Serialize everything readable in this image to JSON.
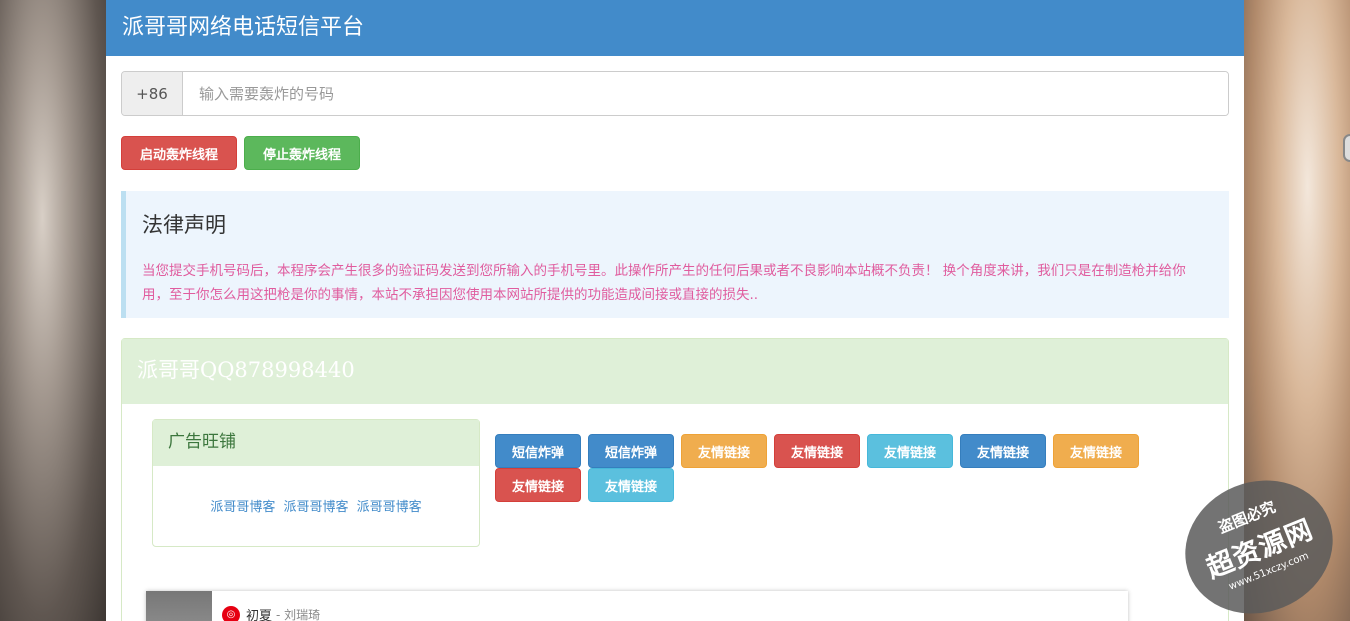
{
  "header": {
    "title": "派哥哥网络电话短信平台"
  },
  "phone": {
    "prefix": "+86",
    "placeholder": "输入需要轰炸的号码"
  },
  "actions": {
    "start_label": "启动轰炸线程",
    "stop_label": "停止轰炸线程"
  },
  "legal": {
    "title": "法律声明",
    "text": "当您提交手机号码后，本程序会产生很多的验证码发送到您所输入的手机号里。此操作所产生的任何后果或者不良影响本站概不负责！ 换个角度来讲，我们只是在制造枪并给你用，至于你怎么用这把枪是你的事情，本站不承担因您使用本网站所提供的功能造成间接或直接的损失.."
  },
  "panel": {
    "heading": "派哥哥QQ878998440"
  },
  "ad": {
    "heading": "广告旺铺",
    "links": [
      "派哥哥博客",
      "派哥哥博客",
      "派哥哥博客"
    ]
  },
  "link_buttons": [
    {
      "label": "短信炸弹",
      "color": "#428bca"
    },
    {
      "label": "短信炸弹",
      "color": "#428bca"
    },
    {
      "label": "友情链接",
      "color": "#f0ad4e"
    },
    {
      "label": "友情链接",
      "color": "#d9534f"
    },
    {
      "label": "友情链接",
      "color": "#5bc0de"
    },
    {
      "label": "友情链接",
      "color": "#428bca"
    },
    {
      "label": "友情链接",
      "color": "#f0ad4e"
    },
    {
      "label": "友情链接",
      "color": "#d9534f"
    },
    {
      "label": "友情链接",
      "color": "#5bc0de"
    }
  ],
  "music": {
    "title": "初夏",
    "artist": "- 刘瑞琦",
    "icon": "netease-music-icon"
  },
  "watermark": {
    "top": "盗图必究",
    "main": "超资源网",
    "url": "www.51xczy.com"
  },
  "colors": {
    "primary": "#428bca",
    "success": "#5cb85c",
    "danger": "#d9534f",
    "warning": "#f0ad4e",
    "info": "#5bc0de"
  }
}
